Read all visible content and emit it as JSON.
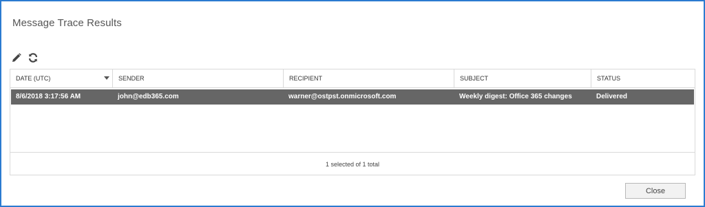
{
  "window": {
    "title": "Message Trace Results"
  },
  "toolbar": {
    "edit_icon": "pencil-icon",
    "refresh_icon": "refresh-icon"
  },
  "grid": {
    "columns": [
      "DATE (UTC)",
      "SENDER",
      "RECIPIENT",
      "SUBJECT",
      "STATUS"
    ],
    "sorted_column": "DATE (UTC)",
    "sort_direction": "descending",
    "rows": [
      {
        "date": "8/6/2018 3:17:56 AM",
        "sender": "john@edb365.com",
        "recipient": "warner@ostpst.onmicrosoft.com",
        "subject": "Weekly digest: Office 365 changes",
        "status": "Delivered",
        "selected": true
      }
    ],
    "footer_text": "1 selected of 1 total"
  },
  "buttons": {
    "close_label": "Close"
  },
  "colors": {
    "frame_border": "#2b7bd0",
    "selected_row": "#666666",
    "grid_border": "#d9d9d9"
  }
}
